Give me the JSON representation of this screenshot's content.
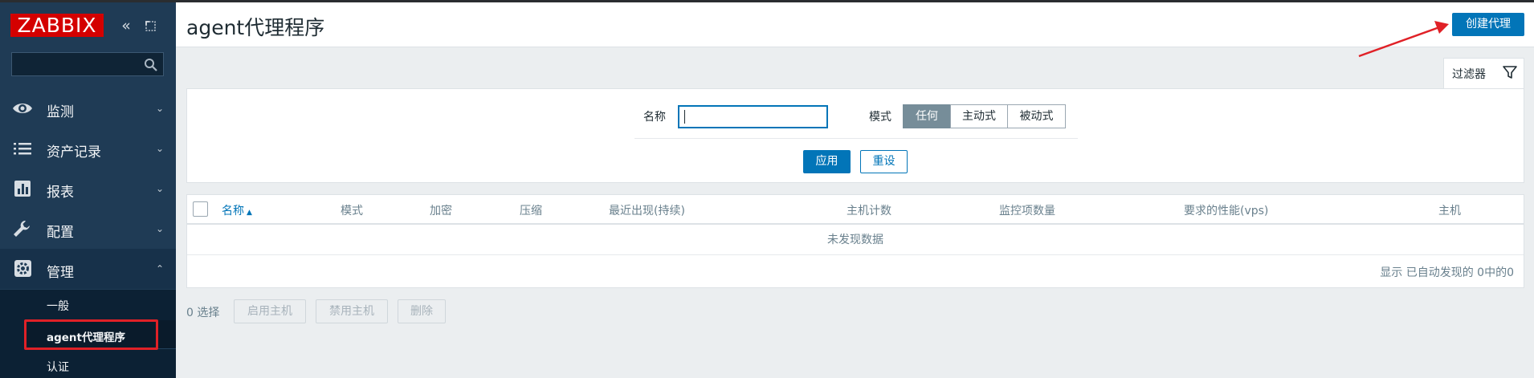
{
  "brand": {
    "logo_text": "ZABBIX",
    "collapse_icon": "double-chevron-left-icon",
    "kiosk_icon": "expand-window-icon"
  },
  "sidebar": {
    "search": {
      "value": "",
      "placeholder": ""
    },
    "menu": [
      {
        "label": "监测",
        "icon": "eye-icon"
      },
      {
        "label": "资产记录",
        "icon": "list-icon"
      },
      {
        "label": "报表",
        "icon": "bar-chart-icon"
      },
      {
        "label": "配置",
        "icon": "wrench-icon"
      },
      {
        "label": "管理",
        "icon": "gear-icon",
        "expanded": true
      }
    ],
    "submenu": [
      {
        "label": "一般"
      },
      {
        "label": "agent代理程序",
        "current": true
      },
      {
        "label": "认证"
      }
    ]
  },
  "header": {
    "title": "agent代理程序",
    "create_button": "创建代理"
  },
  "filter": {
    "tab_label": "过滤器",
    "name_label": "名称",
    "name_value": "",
    "mode_label": "模式",
    "mode_options": [
      "任何",
      "主动式",
      "被动式"
    ],
    "mode_selected": "任何",
    "apply_label": "应用",
    "reset_label": "重设"
  },
  "table": {
    "columns": [
      "名称",
      "模式",
      "加密",
      "压缩",
      "最近出现(持续)",
      "主机计数",
      "监控项数量",
      "要求的性能(vps)",
      "主机"
    ],
    "sorted_column": "名称",
    "sort_direction": "asc",
    "empty_text": "未发现数据",
    "footer_text": "显示 已自动发现的 0中的0"
  },
  "actions": {
    "selected_count": "0 选择",
    "enable_label": "启用主机",
    "disable_label": "禁用主机",
    "delete_label": "删除"
  },
  "colors": {
    "accent": "#0275b8",
    "sidebar_bg": "#1f3b55",
    "logo_red": "#d40000",
    "annotation_red": "#e02127"
  }
}
